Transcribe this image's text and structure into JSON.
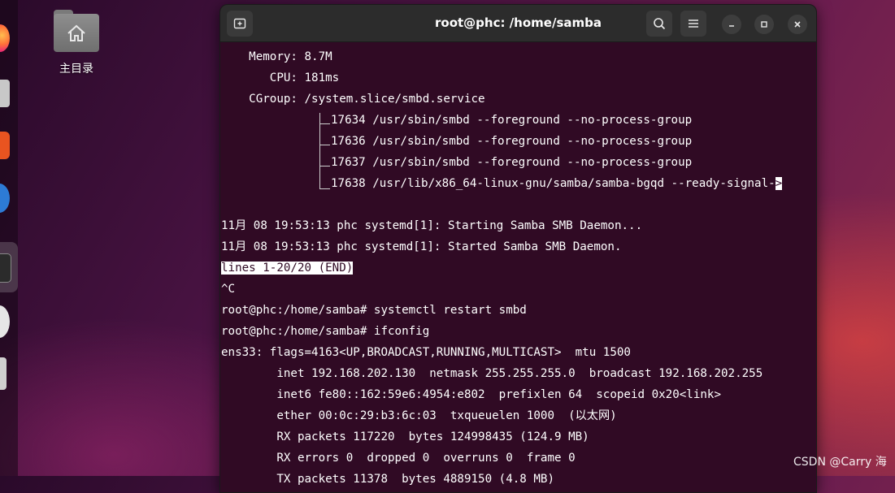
{
  "desktop": {
    "home_label": "主目录"
  },
  "window": {
    "title": "root@phc: /home/samba"
  },
  "terminal": {
    "lines": [
      "    Memory: 8.7M",
      "       CPU: 181ms",
      "    CGroup: /system.slice/smbd.service",
      "17634 /usr/sbin/smbd --foreground --no-process-group",
      "17636 /usr/sbin/smbd --foreground --no-process-group",
      "17637 /usr/sbin/smbd --foreground --no-process-group",
      "17638 /usr/lib/x86_64-linux-gnu/samba/samba-bgqd --ready-signal-",
      "",
      "11月 08 19:53:13 phc systemd[1]: Starting Samba SMB Daemon...",
      "11月 08 19:53:13 phc systemd[1]: Started Samba SMB Daemon.",
      "lines 1-20/20 (END)",
      "^C",
      "root@phc:/home/samba# systemctl restart smbd",
      "root@phc:/home/samba# ifconfig",
      "ens33: flags=4163<UP,BROADCAST,RUNNING,MULTICAST>  mtu 1500",
      "        inet 192.168.202.130  netmask 255.255.255.0  broadcast 192.168.202.255",
      "        inet6 fe80::162:59e6:4954:e802  prefixlen 64  scopeid 0x20<link>",
      "        ether 00:0c:29:b3:6c:03  txqueuelen 1000  (以太网)",
      "        RX packets 117220  bytes 124998435 (124.9 MB)",
      "        RX errors 0  dropped 0  overruns 0  frame 0",
      "        TX packets 11378  bytes 4889150 (4.8 MB)"
    ],
    "truncation_marker": ">"
  },
  "watermark": "CSDN @Carry 海",
  "colors": {
    "terminal_bg": "#300a24",
    "titlebar_bg": "#2c2c2c",
    "text": "#ffffff"
  },
  "icons": {
    "new_tab": "new-tab-icon",
    "search": "search-icon",
    "menu": "hamburger-menu-icon",
    "minimize": "minimize-icon",
    "maximize": "maximize-icon",
    "close": "close-icon",
    "home_folder": "home-folder-icon"
  }
}
